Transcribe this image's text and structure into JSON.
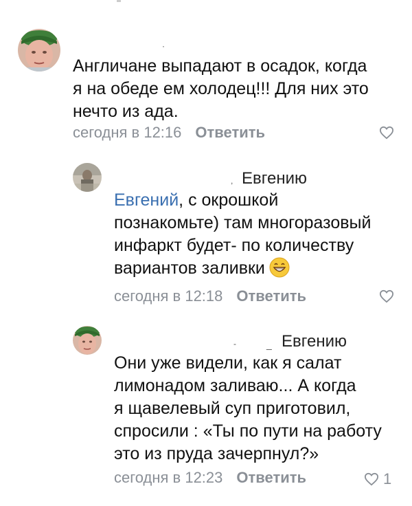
{
  "comments": [
    {
      "author": "",
      "text": "Англичане выпадают в осадок, когда я на обеде ем холодец!!! Для них это нечто из ада.",
      "lines": [
        "Англичане выпадают в осадок, когда",
        "я на обеде ем холодец!!! Для них это",
        "нечто из ада."
      ],
      "time": "сегодня в 12:16",
      "reply_label": "Ответить",
      "likes": ""
    },
    {
      "author": "",
      "reply_to": "Евгению",
      "mention": "Евгений",
      "lines": [
        ", с окрошкой",
        "познакомьте) там многоразовый",
        "инфаркт будет- по количеству",
        "вариантов заливки"
      ],
      "emoji": "grinning-face-emoji",
      "time": "сегодня в 12:18",
      "reply_label": "Ответить",
      "likes": ""
    },
    {
      "author": "",
      "reply_to": "Евгению",
      "lines": [
        "Они уже видели, как я салат",
        "лимонадом заливаю... А когда",
        "я щавелевый суп приготовил,",
        "спросили : «Ты по пути на работу",
        "это из пруда зачерпнул?»"
      ],
      "time": "сегодня в 12:23",
      "reply_label": "Ответить",
      "likes": "1"
    }
  ],
  "icons": {
    "like": "heart-outline-icon",
    "avatar": "avatar-photo"
  },
  "colors": {
    "link": "#3a6fb0",
    "meta": "#8a8f96",
    "text": "#111111"
  }
}
